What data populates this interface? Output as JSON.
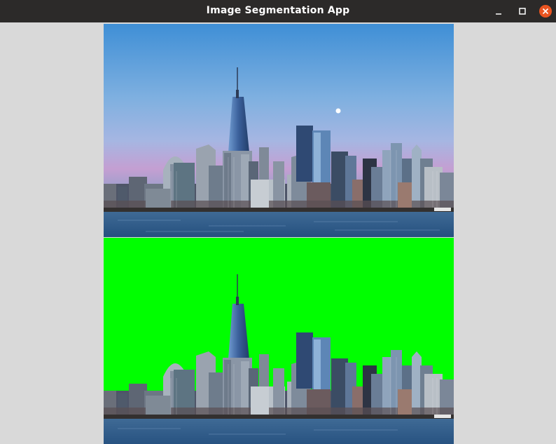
{
  "window": {
    "title": "Image Segmentation App",
    "controls": [
      "minimize-icon",
      "maximize-icon",
      "close-icon"
    ]
  },
  "colors": {
    "titlebar": "#2c2a29",
    "close_button": "#e95420",
    "background": "#d9d9d9",
    "segmentation_mask": "#00ff00"
  },
  "images": {
    "original": {
      "subject": "city-skyline-at-dusk"
    },
    "segmented": {
      "subject": "city-skyline-with-sky-masked-green"
    }
  }
}
